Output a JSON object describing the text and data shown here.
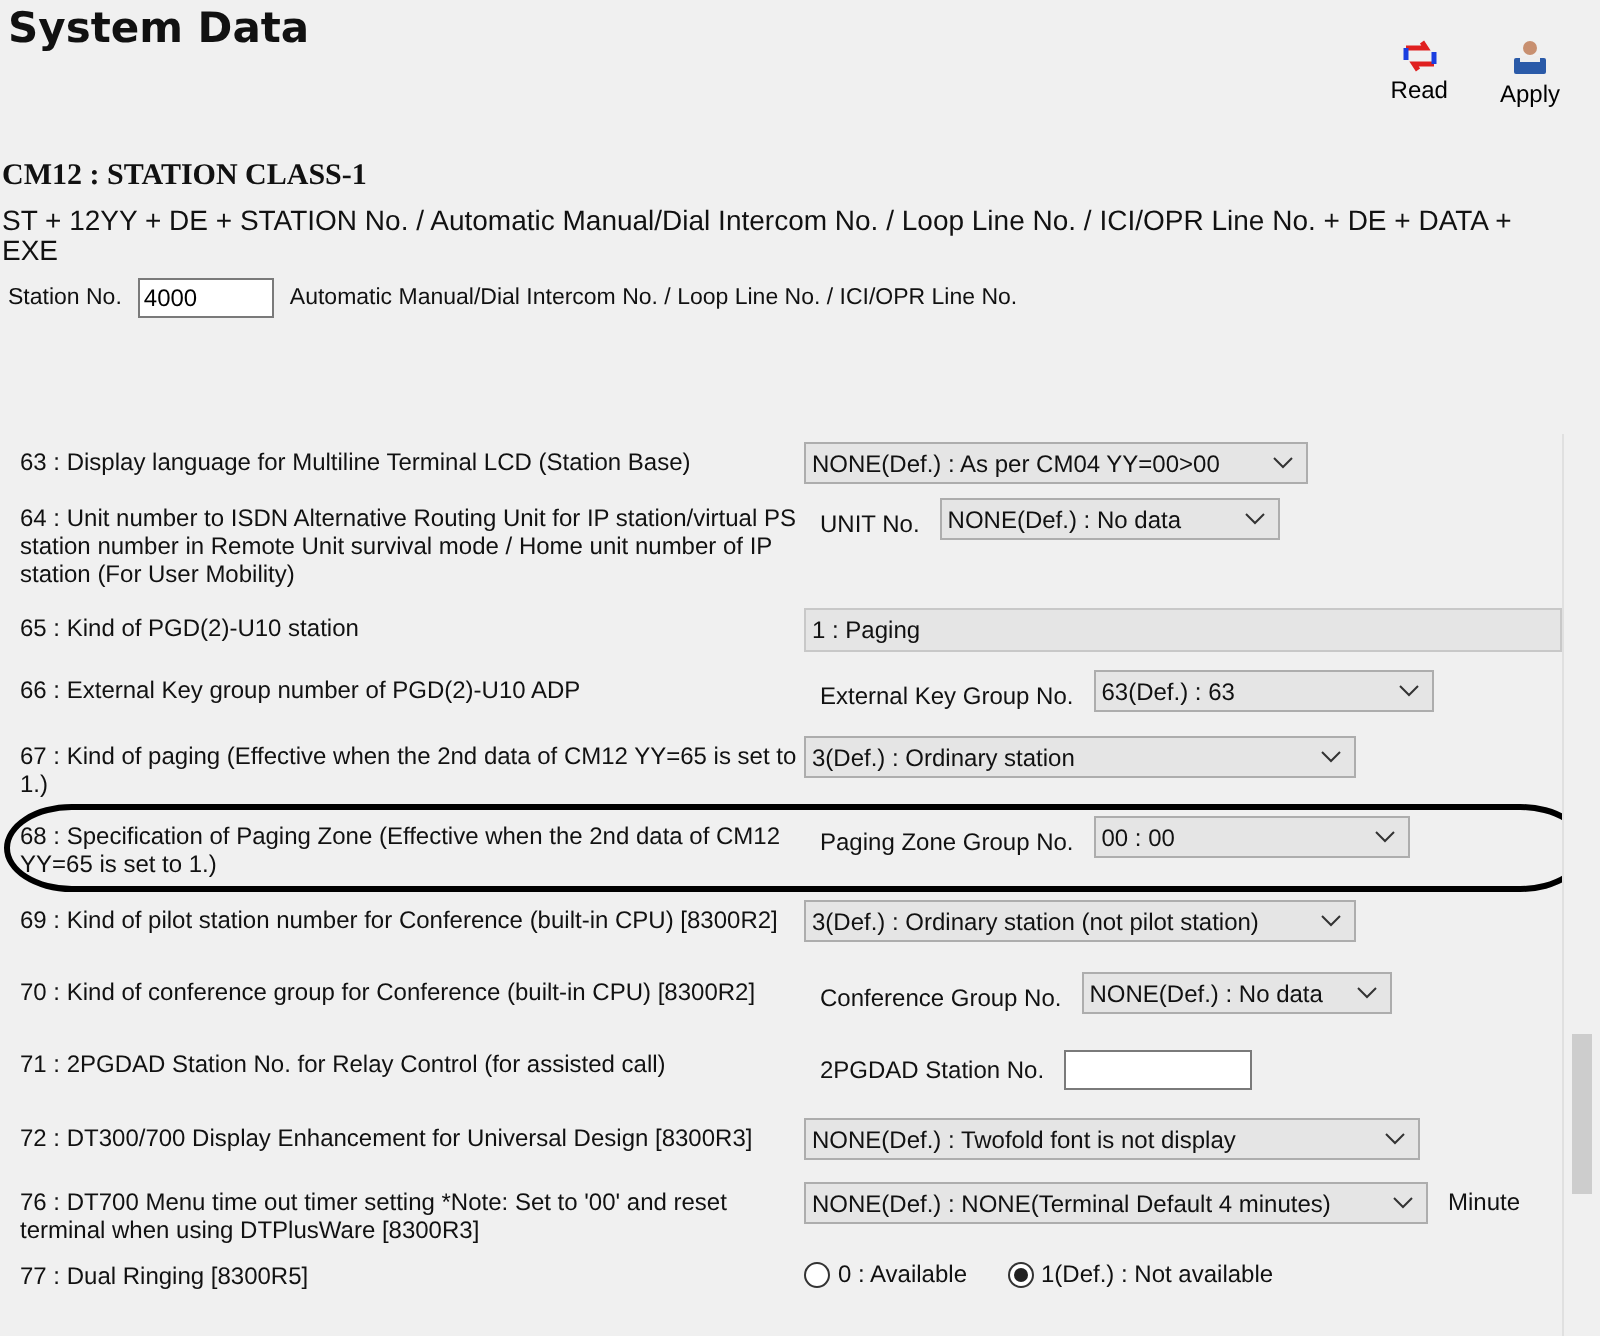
{
  "title": "System Data",
  "toolbar": [
    {
      "kind": "read",
      "label": "Read"
    },
    {
      "kind": "apply",
      "label": "Apply"
    }
  ],
  "command": {
    "title": "CM12 : STATION CLASS-1",
    "syntax": "ST + 12YY + DE + STATION No. / Automatic Manual/Dial Intercom No. / Loop Line No. / ICI/OPR Line No. + DE + DATA + EXE"
  },
  "station": {
    "label": "Station No.",
    "value": "4000",
    "hint": "Automatic Manual/Dial Intercom No. / Loop Line No. / ICI/OPR Line No."
  },
  "rows": [
    {
      "kind": "select",
      "text": "63 : Display language for Multiline Terminal LCD (Station Base)",
      "value": "NONE(Def.) : As per CM04 YY=00>00",
      "highlighted": false
    },
    {
      "kind": "select",
      "text": "64 : Unit number to ISDN Alternative Routing Unit for IP station/virtual PS station number in Remote Unit survival mode / Home unit number of IP station (For User Mobility)",
      "label": "UNIT No.",
      "value": "NONE(Def.) : No data",
      "highlighted": false
    },
    {
      "kind": "readonly",
      "text": "65 : Kind of PGD(2)-U10 station",
      "value": "1 : Paging",
      "highlighted": false
    },
    {
      "kind": "select",
      "text": "66 : External Key group number of PGD(2)-U10 ADP",
      "label": "External Key Group No.",
      "value": "63(Def.) :  63",
      "highlighted": false
    },
    {
      "kind": "select",
      "text": "67 : Kind of paging (Effective when the 2nd data of CM12 YY=65 is set to 1.)",
      "value": "3(Def.) : Ordinary station",
      "highlighted": false
    },
    {
      "kind": "select",
      "text": "68 : Specification of Paging Zone (Effective when the 2nd data of CM12 YY=65 is set to 1.)",
      "label": "Paging Zone Group No.",
      "value": "00 :  00",
      "highlighted": true
    },
    {
      "kind": "select",
      "text": "69 : Kind of pilot station number for Conference (built-in CPU) [8300R2]",
      "value": "3(Def.) : Ordinary station (not pilot station)",
      "highlighted": false
    },
    {
      "kind": "select",
      "text": "70 : Kind of conference group for Conference (built-in CPU) [8300R2]",
      "label": "Conference Group No.",
      "value": "NONE(Def.) : No data",
      "highlighted": false
    },
    {
      "kind": "input",
      "text": "71 : 2PGDAD Station No. for Relay Control (for assisted call)",
      "label": "2PGDAD Station No.",
      "value": "",
      "highlighted": false
    },
    {
      "kind": "select",
      "text": "72 : DT300/700 Display Enhancement for Universal Design [8300R3]",
      "value": "NONE(Def.) : Twofold font is not display",
      "highlighted": false
    },
    {
      "kind": "select",
      "text": "76 : DT700 Menu time out timer setting *Note: Set to '00' and reset terminal when using DTPlusWare [8300R3]",
      "value": "NONE(Def.) : NONE(Terminal Default 4 minutes)",
      "suffix": "Minute",
      "highlighted": false
    },
    {
      "kind": "radio",
      "text": "77 : Dual Ringing  [8300R5]",
      "options": [
        {
          "label": "0 : Available",
          "selected": false
        },
        {
          "label": "1(Def.) : Not available",
          "selected": true
        }
      ],
      "highlighted": false
    }
  ]
}
